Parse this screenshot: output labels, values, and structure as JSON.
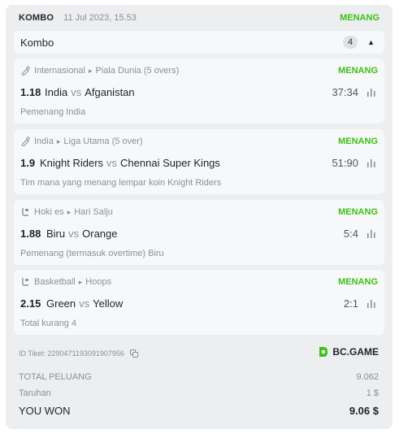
{
  "header": {
    "type_label": "KOMBO",
    "date": "11 Jul 2023, 15.53",
    "status": "MENANG"
  },
  "group": {
    "label": "Kombo",
    "count": "4"
  },
  "bets": [
    {
      "sport_icon": "cricket-icon",
      "category": "Internasional",
      "league": "Piala Dunia (5 overs)",
      "status": "MENANG",
      "odds": "1.18",
      "home": "India",
      "vs": "vs",
      "away": "Afganistan",
      "score": "37:34",
      "pick": "Pemenang India"
    },
    {
      "sport_icon": "cricket-icon",
      "category": "India",
      "league": "Liga Utama (5 over)",
      "status": "MENANG",
      "odds": "1.9",
      "home": "Knight Riders",
      "vs": "vs",
      "away": "Chennai Super Kings",
      "score": "51:90",
      "pick": "Tim mana yang menang lempar koin Knight Riders"
    },
    {
      "sport_icon": "ice-hockey-icon",
      "category": "Hoki es",
      "league": "Hari Salju",
      "status": "MENANG",
      "odds": "1.88",
      "home": "Biru",
      "vs": "vs",
      "away": "Orange",
      "score": "5:4",
      "pick": "Pemenang (termasuk overtime) Biru"
    },
    {
      "sport_icon": "basketball-icon",
      "category": "Basketball",
      "league": "Hoops",
      "status": "MENANG",
      "odds": "2.15",
      "home": "Green",
      "vs": "vs",
      "away": "Yellow",
      "score": "2:1",
      "pick": "Total kurang 4"
    }
  ],
  "footer": {
    "ticket_id": "ID Tiket: 2290471193091907956",
    "brand": "BC.GAME",
    "total_odds_label": "TOTAL PELUANG",
    "total_odds_value": "9.062",
    "stake_label": "Taruhan",
    "stake_value": "1 $",
    "won_label": "YOU WON",
    "won_value": "9.06 $"
  },
  "colors": {
    "win_green": "#3bc117",
    "panel": "#eceef0",
    "card": "#f7f8f9"
  }
}
